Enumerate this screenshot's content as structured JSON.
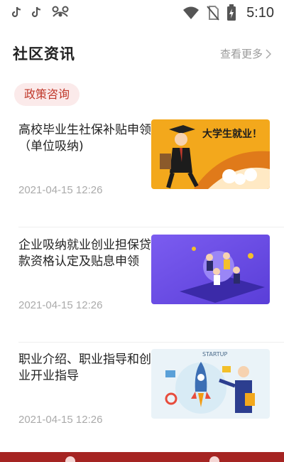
{
  "status_bar": {
    "time": "5:10",
    "icons": [
      "tiktok-icon",
      "tiktok-icon",
      "app-icon",
      "wifi-icon",
      "no-sim-icon",
      "battery-icon"
    ]
  },
  "section": {
    "title": "社区资讯",
    "more_label": "查看更多",
    "tag": "政策咨询"
  },
  "news": [
    {
      "title": "高校毕业生社保补贴申领（单位吸纳)",
      "date": "2021-04-15 12:26",
      "thumb_text": "大学生就业！"
    },
    {
      "title": "企业吸纳就业创业担保贷款资格认定及贴息申领",
      "date": "2021-04-15 12:26"
    },
    {
      "title": "职业介绍、职业指导和创业开业指导",
      "date": "2021-04-15 12:26",
      "thumb_text": "STARTUP"
    }
  ],
  "colors": {
    "accent": "#a52422",
    "tag_bg": "#fbeaea",
    "tag_text": "#c0392b"
  }
}
